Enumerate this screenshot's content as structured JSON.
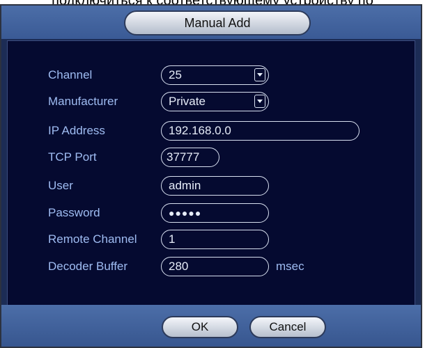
{
  "background_text": "подключиться к соответствующему устройству по",
  "dialog": {
    "title": "Manual Add",
    "fields": {
      "channel": {
        "label": "Channel",
        "value": "25"
      },
      "manufacturer": {
        "label": "Manufacturer",
        "value": "Private"
      },
      "ip_address": {
        "label": "IP Address",
        "value": "192.168.0.0"
      },
      "tcp_port": {
        "label": "TCP Port",
        "value": "37777"
      },
      "user": {
        "label": "User",
        "value": "admin"
      },
      "password": {
        "label": "Password",
        "value": "●●●●●"
      },
      "remote_channel": {
        "label": "Remote Channel",
        "value": "1"
      },
      "decoder_buffer": {
        "label": "Decoder Buffer",
        "value": "280",
        "unit": "msec"
      }
    },
    "buttons": {
      "ok": "OK",
      "cancel": "Cancel"
    }
  },
  "colors": {
    "titlebar": "#4c6ea8",
    "content_bg": "#050a30",
    "label_text": "#9fbcf2",
    "field_text": "#e6ecf8"
  }
}
